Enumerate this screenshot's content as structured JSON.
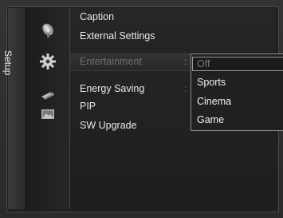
{
  "side_tab": {
    "label": "Setup"
  },
  "icons": [
    "satellite-dish-icon",
    "gear-icon",
    "remote-control-icon",
    "picture-icon"
  ],
  "menu": {
    "items": [
      {
        "label": "Caption",
        "state": "normal"
      },
      {
        "label": "External Settings",
        "state": "normal"
      },
      {
        "label": "Entertainment",
        "state": "highlighted",
        "separator": ":"
      },
      {
        "label": "Energy Saving",
        "state": "normal",
        "separator": ":"
      },
      {
        "label": "PIP",
        "state": "normal"
      },
      {
        "label": "SW Upgrade",
        "state": "normal"
      }
    ]
  },
  "dropdown": {
    "selected": "Off",
    "options": [
      "Off",
      "Sports",
      "Cinema",
      "Game"
    ]
  }
}
